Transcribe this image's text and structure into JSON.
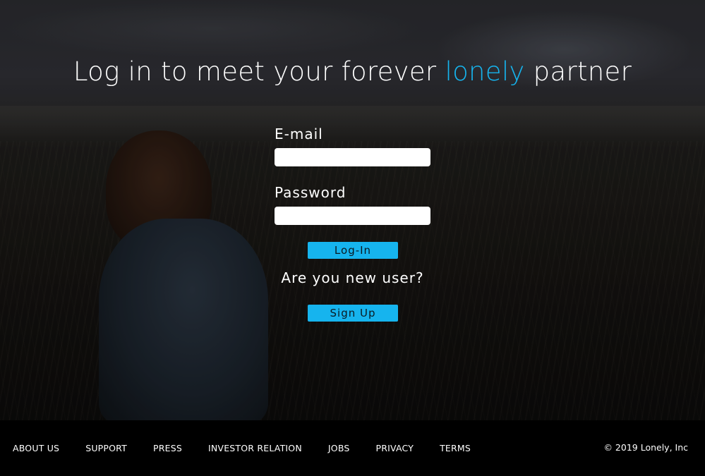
{
  "hero": {
    "title_before": "Log in to meet your forever ",
    "title_accent": "lonely",
    "title_after": " partner",
    "accent_color": "#16b4ee",
    "background_image": "woman sitting in a field of grass at dusk"
  },
  "login_form": {
    "email_label": "E-mail",
    "email_value": "",
    "password_label": "Password",
    "password_value": "",
    "login_button_label": "Log-In",
    "new_user_prompt": "Are you new user?",
    "signup_button_label": "Sign Up"
  },
  "footer": {
    "nav_items": [
      {
        "label": "ABOUT US"
      },
      {
        "label": "SUPPORT"
      },
      {
        "label": "PRESS"
      },
      {
        "label": "INVESTOR RELATION"
      },
      {
        "label": "JOBS"
      },
      {
        "label": "PRIVACY"
      },
      {
        "label": "TERMS"
      }
    ],
    "copyright": "© 2019 Lonely, Inc"
  }
}
